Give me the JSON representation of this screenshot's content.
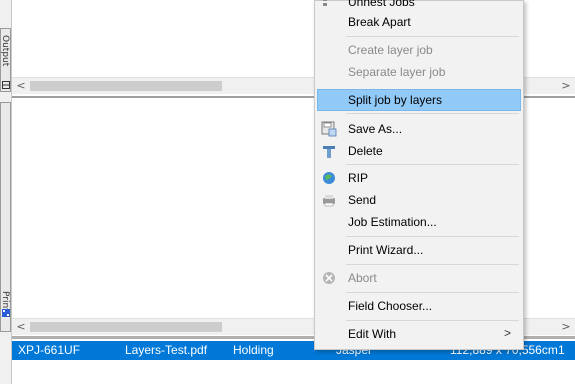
{
  "left_tabs": {
    "output_label": "Output",
    "queue_label": "Print"
  },
  "job_row": {
    "name": "XPJ-661UF",
    "file": "Layers-Test.pdf",
    "status": "Holding",
    "printer": "Jasper",
    "size": "112,889 x 70,556cm",
    "copies": "1"
  },
  "context_menu": {
    "items": [
      {
        "label": "Unnest Jobs",
        "enabled": true,
        "icon": "unnest-icon"
      },
      {
        "label": "Break Apart",
        "enabled": true
      },
      {
        "label": "Create layer job",
        "enabled": false
      },
      {
        "label": "Separate layer job",
        "enabled": false
      },
      {
        "label": "Split job by layers",
        "enabled": true,
        "highlighted": true
      },
      {
        "label": "Save As...",
        "enabled": true,
        "icon": "save-as-icon"
      },
      {
        "label": "Delete",
        "enabled": true,
        "icon": "delete-icon"
      },
      {
        "label": "RIP",
        "enabled": true,
        "icon": "rip-globe-icon"
      },
      {
        "label": "Send",
        "enabled": true,
        "icon": "send-printer-icon"
      },
      {
        "label": "Job Estimation...",
        "enabled": true
      },
      {
        "label": "Print Wizard...",
        "enabled": true
      },
      {
        "label": "Abort",
        "enabled": false,
        "icon": "abort-icon"
      },
      {
        "label": "Field Chooser...",
        "enabled": true
      },
      {
        "label": "Edit With",
        "enabled": true,
        "submenu": true
      }
    ],
    "submenu_arrow": ">"
  },
  "scrollbars": {
    "left_arrow": "<",
    "right_arrow": ">"
  },
  "colors": {
    "selection": "#0078d7",
    "menu_highlight": "#91c9f7"
  }
}
